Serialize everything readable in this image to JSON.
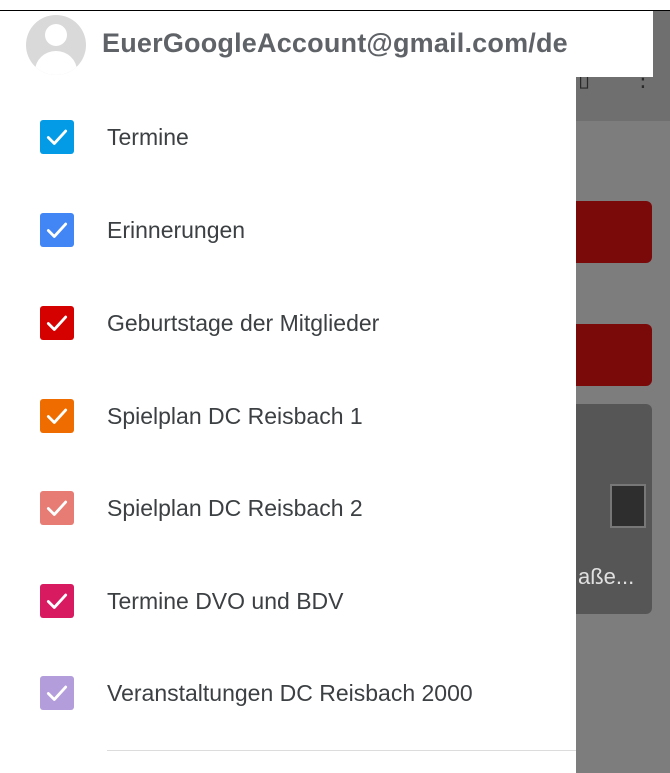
{
  "account": {
    "email": "EuerGoogleAccount@gmail.com/de"
  },
  "calendars": [
    {
      "label": "Termine",
      "checked": true,
      "color": "#039be5"
    },
    {
      "label": "Erinnerungen",
      "checked": true,
      "color": "#4285f4"
    },
    {
      "label": "Geburtstage der Mitglieder",
      "checked": true,
      "color": "#d50000"
    },
    {
      "label": "Spielplan DC Reisbach 1",
      "checked": true,
      "color": "#ef6c00"
    },
    {
      "label": "Spielplan DC Reisbach 2",
      "checked": true,
      "color": "#e67c73"
    },
    {
      "label": "Termine DVO und BDV",
      "checked": true,
      "color": "#d81b60"
    },
    {
      "label": "Veranstaltungen DC Reisbach 2000",
      "checked": true,
      "color": "#b39ddb"
    }
  ],
  "background": {
    "event_color": "#7a0a0a",
    "photo_caption": "aße..."
  }
}
